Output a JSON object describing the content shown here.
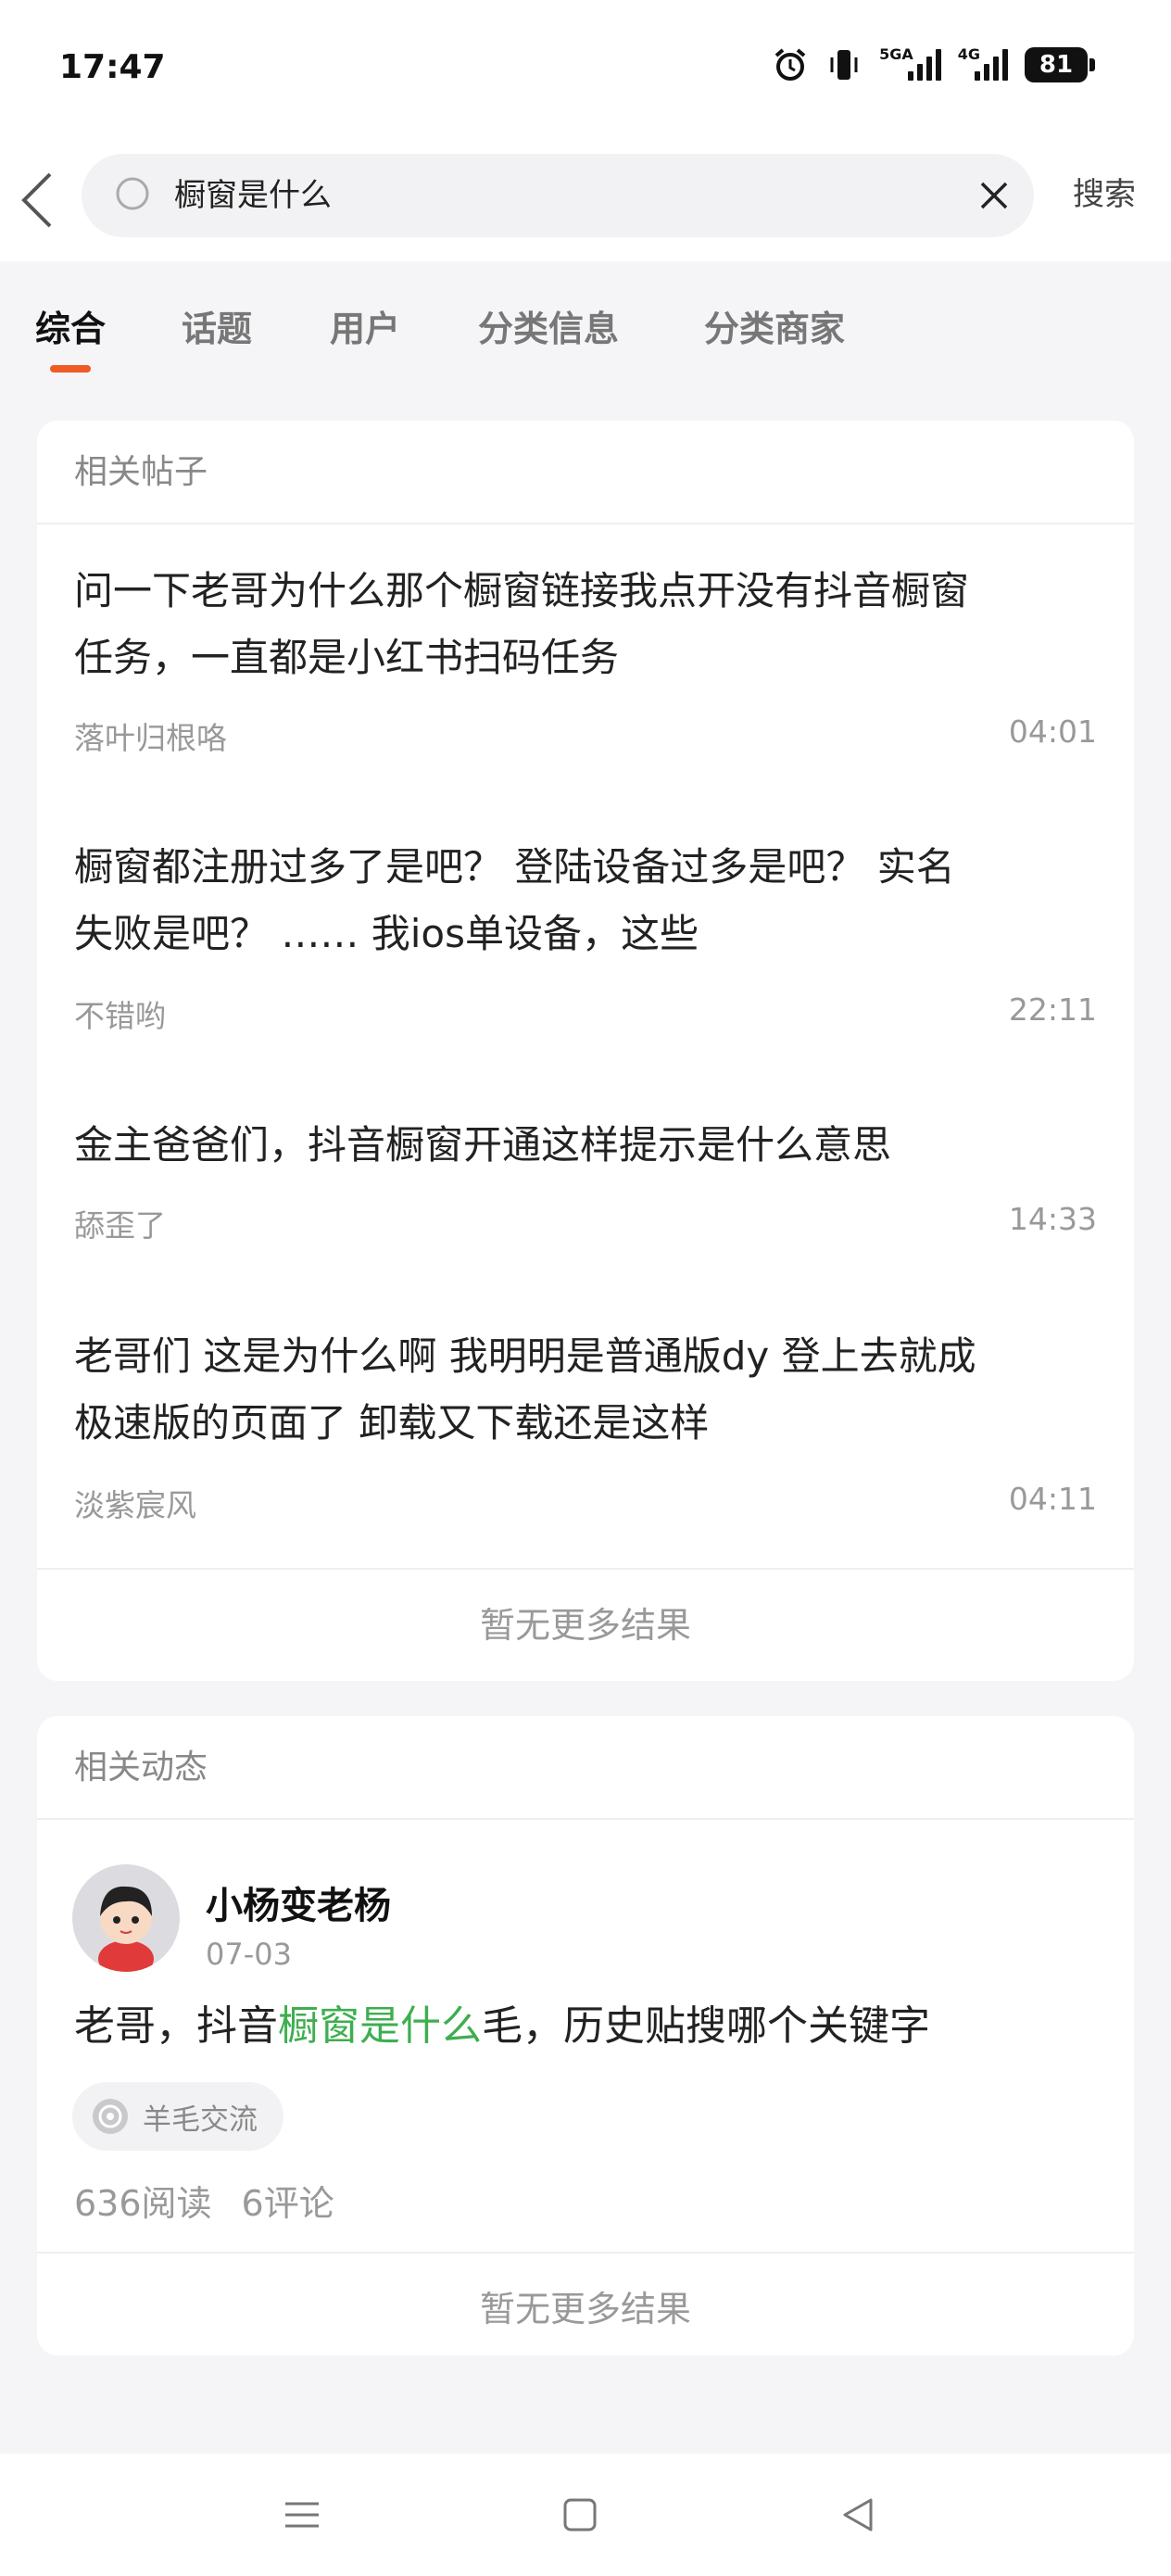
{
  "status_bar": {
    "time": "17:47",
    "icons": [
      "alarm-icon",
      "vibrate-icon",
      "signal-5g-icon",
      "signal-4g-icon"
    ],
    "net1": "5GA",
    "net2": "4G",
    "battery": "81"
  },
  "search": {
    "query": "橱窗是什么",
    "button": "搜索"
  },
  "tabs": [
    {
      "label": "综合",
      "active": true
    },
    {
      "label": "话题",
      "active": false
    },
    {
      "label": "用户",
      "active": false
    },
    {
      "label": "分类信息",
      "active": false
    },
    {
      "label": "分类商家",
      "active": false
    }
  ],
  "related_posts": {
    "title": "相关帖子",
    "items": [
      {
        "title_line1": "问一下老哥为什么那个橱窗链接我点开没有抖音橱窗",
        "title_line2": "任务，一直都是小红书扫码任务",
        "author": "落叶归根咯",
        "time": "04:01"
      },
      {
        "title_line1": "橱窗都注册过多了是吧？ 登陆设备过多是吧？ 实名",
        "title_line2": "失败是吧？ …… 我ios单设备，这些",
        "author": "不错哟",
        "time": "22:11"
      },
      {
        "title_line1": "金主爸爸们，抖音橱窗开通这样提示是什么意思",
        "title_line2": "",
        "author": "舔歪了",
        "time": "14:33"
      },
      {
        "title_line1": "老哥们 这是为什么啊 我明明是普通版dy 登上去就成",
        "title_line2": "极速版的页面了 卸载又下载还是这样",
        "author": "淡紫宸风",
        "time": "04:11"
      }
    ],
    "no_more": "暂无更多结果"
  },
  "related_dynamics": {
    "title": "相关动态",
    "item": {
      "username": "小杨变老杨",
      "date": "07-03",
      "text_before": "老哥，抖音",
      "text_highlight": "橱窗是什么",
      "text_after": "毛，历史贴搜哪个关键字",
      "tag": "羊毛交流",
      "reads": "636阅读",
      "comments": "6评论"
    },
    "no_more": "暂无更多结果"
  },
  "colors": {
    "accent": "#f05a24",
    "highlight": "#3eae4f"
  }
}
